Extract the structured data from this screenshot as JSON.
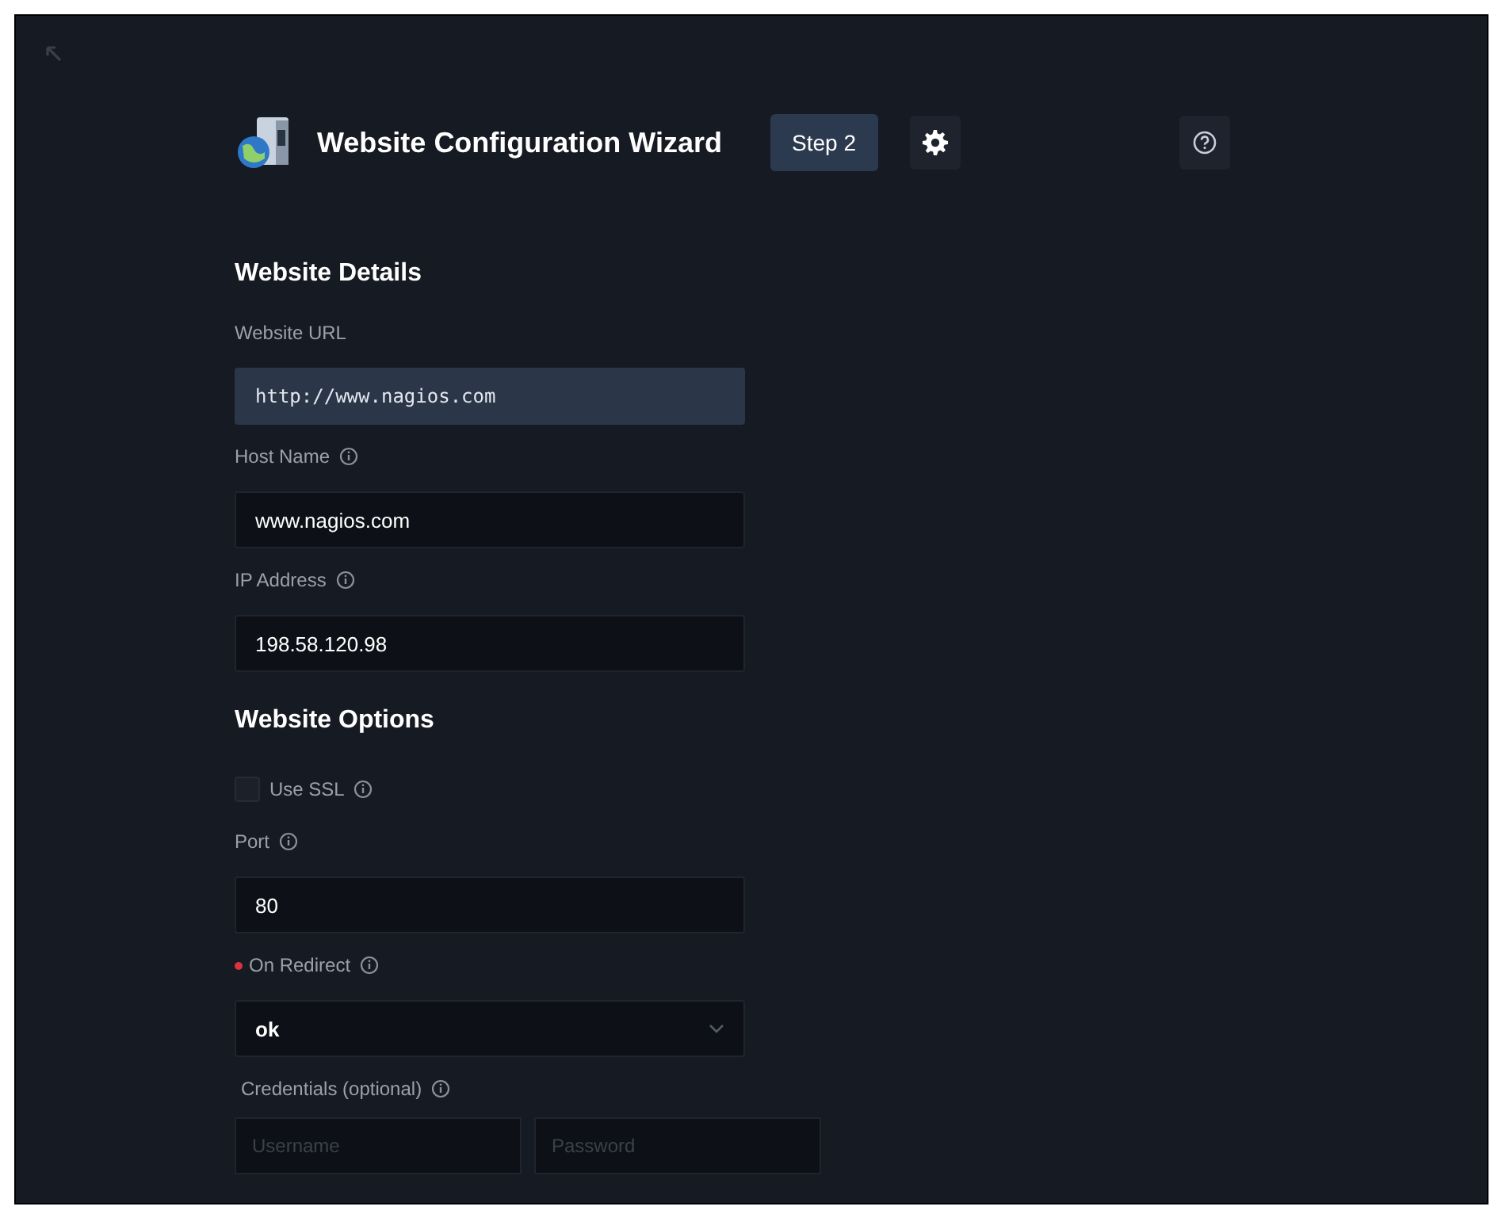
{
  "header": {
    "title": "Website Configuration Wizard",
    "step": "Step 2"
  },
  "sections": [
    {
      "title": "Website Details",
      "fields": [
        {
          "kind": "input",
          "label": "Website URL",
          "info": false,
          "required": false,
          "readonly": true,
          "value": "http://www.nagios.com"
        },
        {
          "kind": "input",
          "label": "Host Name",
          "info": true,
          "required": false,
          "readonly": false,
          "value": "www.nagios.com"
        },
        {
          "kind": "input",
          "label": "IP Address",
          "info": true,
          "required": false,
          "readonly": false,
          "value": "198.58.120.98"
        }
      ]
    },
    {
      "title": "Website Options",
      "fields": [
        {
          "kind": "checkbox",
          "label": "Use SSL",
          "info": true,
          "checked": false
        },
        {
          "kind": "input",
          "label": "Port",
          "info": true,
          "required": false,
          "readonly": false,
          "value": "80"
        },
        {
          "kind": "select",
          "label": "On Redirect",
          "info": true,
          "required": true,
          "value": "ok"
        },
        {
          "kind": "pair",
          "label": "Credentials (optional)",
          "info": true,
          "required": false,
          "inputs": [
            {
              "placeholder": "Username"
            },
            {
              "placeholder": "Password"
            }
          ]
        }
      ]
    }
  ]
}
